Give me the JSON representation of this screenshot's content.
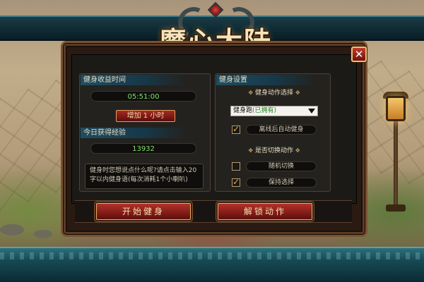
{
  "logo": {
    "title": "魔心大陆"
  },
  "window": {
    "close_label": "✕"
  },
  "left": {
    "income_header": "健身收益时间",
    "income_time": "05:51:00",
    "add_hour_label": "增加 1 小时",
    "exp_header": "今日获得经验",
    "exp_value": "13932",
    "message": "健身时您想说点什么呢?请点击输入20字以内健身语(每次消耗1个小喇叭)"
  },
  "right": {
    "settings_header": "健身设置",
    "action_select_title": "健身动作选择",
    "selected_action": "健身跑",
    "selected_action_status": "(已拥有)",
    "auto_offline_label": "离线后自动健身",
    "auto_offline_checked": true,
    "switch_title": "是否切换动作",
    "random_switch_label": "随机切换",
    "random_switch_checked": false,
    "keep_choice_label": "保持选择",
    "keep_choice_checked": true
  },
  "buttons": {
    "start": "开始健身",
    "unlock": "解锁动作"
  },
  "colors": {
    "accent_green": "#7fe06a",
    "button_red": "#a52a24",
    "gold_border": "#e2b06a"
  }
}
